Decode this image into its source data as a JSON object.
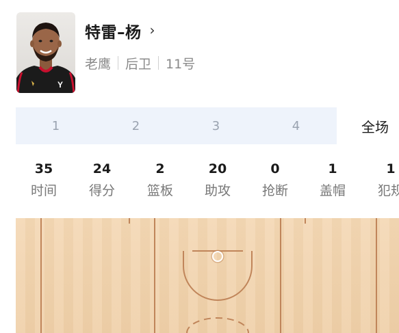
{
  "player": {
    "name": "特雷–杨",
    "chevron": "›",
    "team": "老鹰",
    "position": "后卫",
    "number": "11号"
  },
  "tabs": [
    "1",
    "2",
    "3",
    "4",
    "全场"
  ],
  "active_tab": "全场",
  "stats": [
    {
      "value": "35",
      "label": "时间"
    },
    {
      "value": "24",
      "label": "得分"
    },
    {
      "value": "2",
      "label": "篮板"
    },
    {
      "value": "20",
      "label": "助攻"
    },
    {
      "value": "0",
      "label": "抢断"
    },
    {
      "value": "1",
      "label": "盖帽"
    },
    {
      "value": "1",
      "label": "犯规"
    }
  ],
  "colors": {
    "tab_bg": "#eef3fb",
    "court_wood": "#f0d0a8",
    "court_lines": "#c0855a",
    "jersey": "#1b1b1b",
    "jersey_trim": "#c8102e"
  }
}
